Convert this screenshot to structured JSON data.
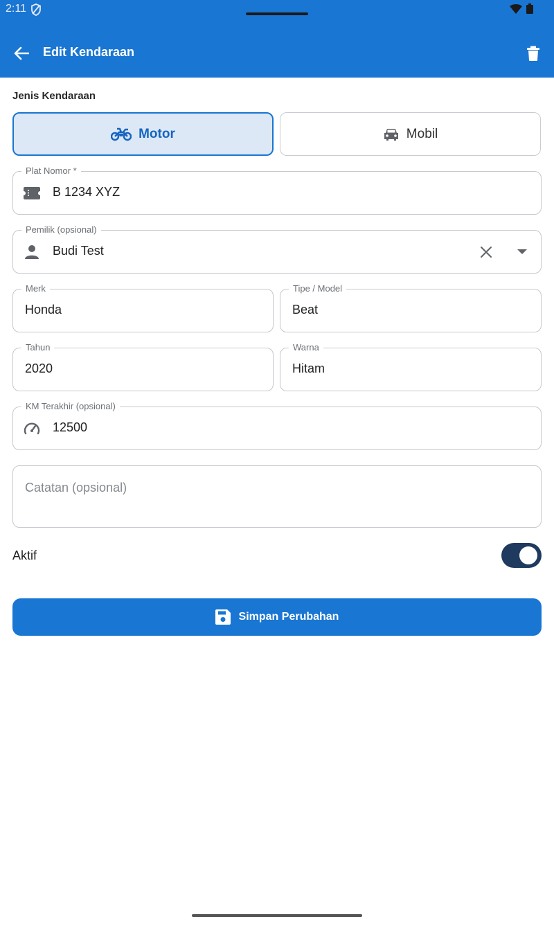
{
  "status_bar": {
    "time": "2:11"
  },
  "app_bar": {
    "title": "Edit Kendaraan"
  },
  "form": {
    "vehicle_type_label": "Jenis Kendaraan",
    "vehicle_types": [
      {
        "label": "Motor",
        "selected": true
      },
      {
        "label": "Mobil",
        "selected": false
      }
    ],
    "plate": {
      "label": "Plat Nomor *",
      "value": "B 1234 XYZ"
    },
    "owner": {
      "label": "Pemilik (opsional)",
      "value": "Budi Test"
    },
    "brand": {
      "label": "Merk",
      "value": "Honda"
    },
    "model": {
      "label": "Tipe / Model",
      "value": "Beat"
    },
    "year": {
      "label": "Tahun",
      "value": "2020"
    },
    "color": {
      "label": "Warna",
      "value": "Hitam"
    },
    "odometer": {
      "label": "KM Terakhir (opsional)",
      "value": "12500"
    },
    "notes": {
      "placeholder": "Catatan (opsional)",
      "value": ""
    },
    "active": {
      "label": "Aktif",
      "on": true
    }
  },
  "save_button": {
    "label": "Simpan Perubahan"
  },
  "colors": {
    "primary": "#1976d2",
    "selected_bg": "#dde8f6",
    "toggle_on": "#1f3a5f"
  }
}
